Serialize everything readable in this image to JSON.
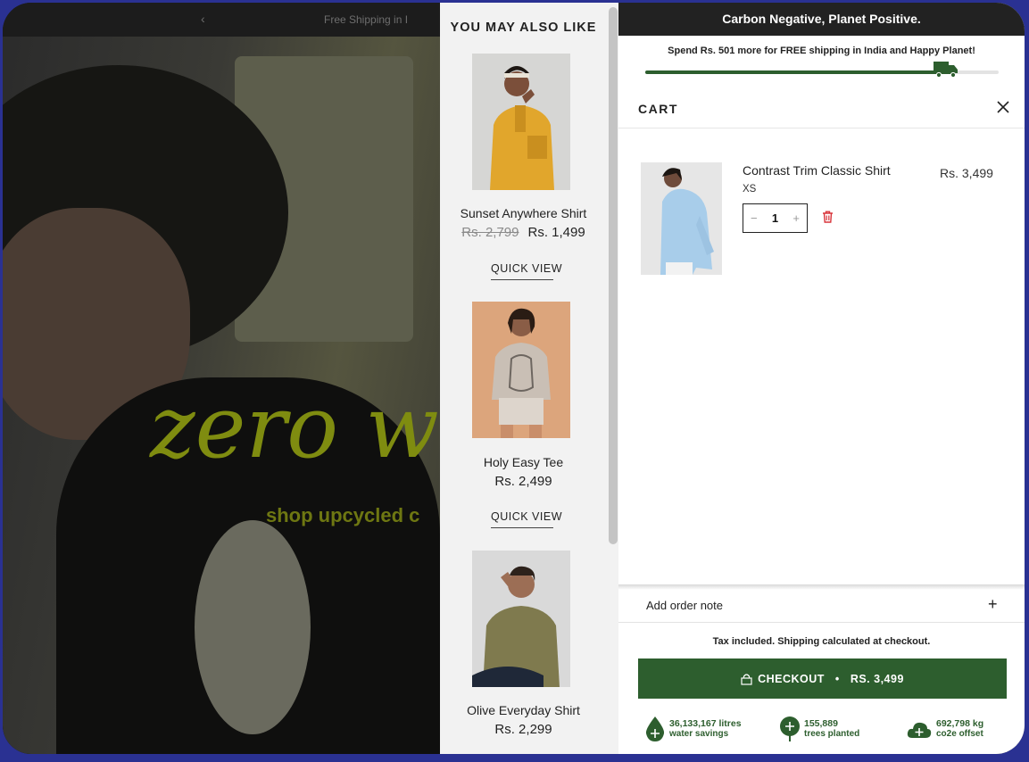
{
  "hero": {
    "topbar_text": "Free Shipping in I",
    "headline": "zero w",
    "tagline": "shop upcycled c"
  },
  "recommendations": {
    "title": "YOU MAY ALSO LIKE",
    "items": [
      {
        "name": "Sunset Anywhere Shirt",
        "old_price": "Rs. 2,799",
        "price": "Rs. 1,499",
        "quick_view": "QUICK VIEW"
      },
      {
        "name": "Holy Easy Tee",
        "old_price": "",
        "price": "Rs. 2,499",
        "quick_view": "QUICK VIEW"
      },
      {
        "name": "Olive Everyday Shirt",
        "old_price": "",
        "price": "Rs. 2,299",
        "quick_view": "QUICK VIEW"
      }
    ]
  },
  "cart": {
    "announcement": "Carbon Negative, Planet Positive.",
    "shipping_message": "Spend Rs. 501 more for FREE shipping in India and Happy Planet!",
    "shipping_progress": 0.88,
    "title": "CART",
    "items": [
      {
        "name": "Contrast Trim Classic Shirt",
        "variant": "XS",
        "quantity": "1",
        "price": "Rs. 3,499"
      }
    ],
    "order_note_label": "Add order note",
    "tax_note": "Tax included. Shipping calculated at checkout.",
    "checkout_label": "CHECKOUT",
    "checkout_total": "RS. 3,499",
    "impact": [
      {
        "value": "36,133,167 litres",
        "label": "water savings"
      },
      {
        "value": "155,889",
        "label": "trees planted"
      },
      {
        "value": "692,798 kg",
        "label": "co2e offset"
      }
    ]
  },
  "colors": {
    "brand_green": "#2d5e2e",
    "announce_bg": "#222222",
    "frame": "#2a3192",
    "delete_red": "#d8343a"
  }
}
